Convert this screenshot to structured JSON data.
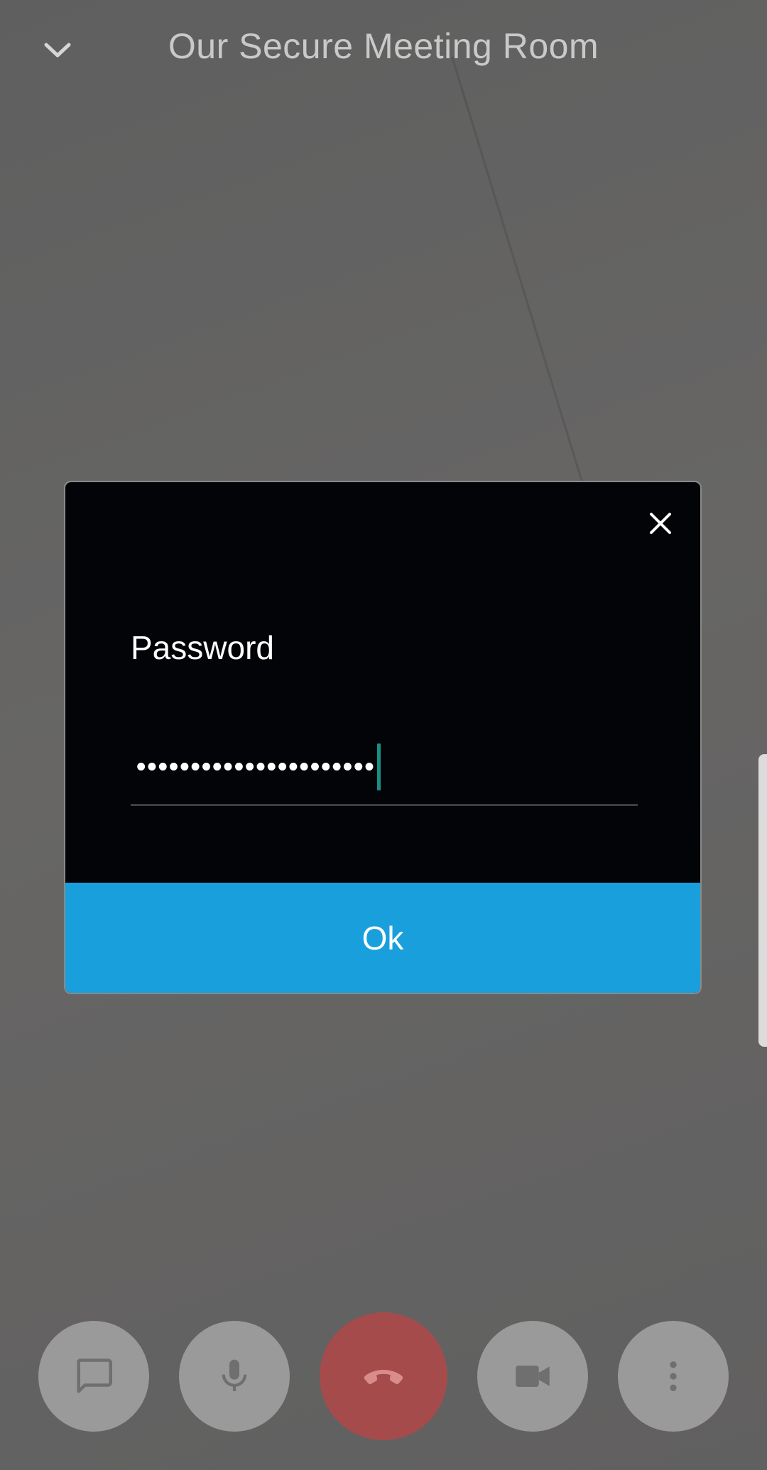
{
  "header": {
    "title": "Our Secure Meeting Room",
    "collapse_icon": "chevron-down-icon"
  },
  "dialog": {
    "close_icon": "close-icon",
    "label": "Password",
    "password_masked": "••••••••••••••••••••••",
    "ok_label": "Ok"
  },
  "controls": {
    "items": [
      {
        "name": "chat",
        "icon": "chat-icon"
      },
      {
        "name": "microphone",
        "icon": "microphone-icon"
      },
      {
        "name": "hangup",
        "icon": "hangup-icon"
      },
      {
        "name": "camera",
        "icon": "video-camera-icon"
      },
      {
        "name": "more",
        "icon": "more-vertical-icon"
      }
    ]
  },
  "colors": {
    "ok_button": "#19a0dc",
    "hangup": "#a64b4b",
    "caret": "#1a8f86"
  }
}
